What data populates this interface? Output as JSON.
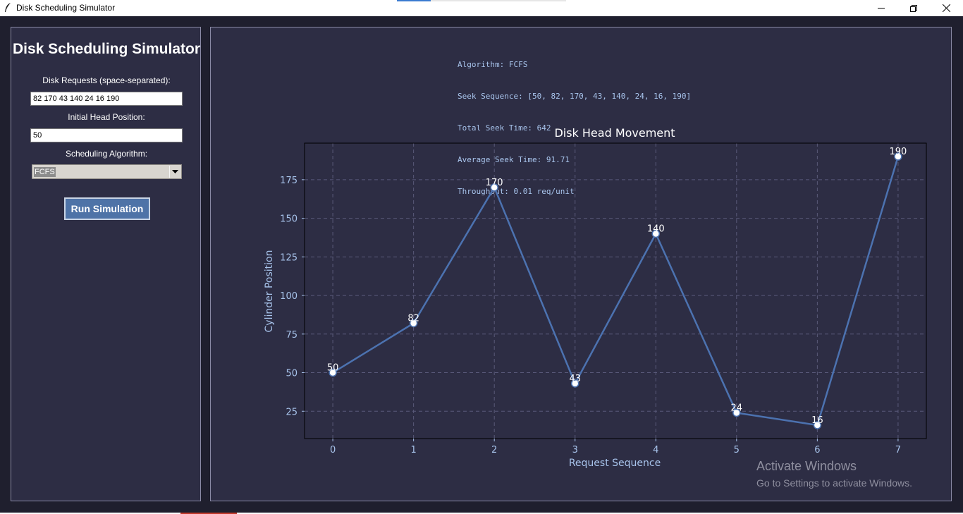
{
  "window": {
    "title": "Disk Scheduling Simulator",
    "icons": [
      "feather-app-icon",
      "minimize-icon",
      "maximize-icon",
      "close-icon"
    ]
  },
  "form": {
    "title": "Disk Scheduling Simulator",
    "requests_label": "Disk Requests (space-separated):",
    "requests_value": "82 170 43 140 24 16 190",
    "head_label": "Initial Head Position:",
    "head_value": "50",
    "algorithm_label": "Scheduling Algorithm:",
    "algorithm_value": "FCFS",
    "run_button": "Run Simulation"
  },
  "results": {
    "algorithm": "Algorithm: FCFS",
    "sequence": "Seek Sequence: [50, 82, 170, 43, 140, 24, 16, 190]",
    "total": "Total Seek Time: 642",
    "average": "Average Seek Time: 91.71",
    "throughput": "Throughput: 0.01 req/unit"
  },
  "chart_data": {
    "type": "line",
    "title": "Disk Head Movement",
    "xlabel": "Request Sequence",
    "ylabel": "Cylinder Position",
    "x": [
      0,
      1,
      2,
      3,
      4,
      5,
      6,
      7
    ],
    "values": [
      50,
      82,
      170,
      43,
      140,
      24,
      16,
      190
    ],
    "point_labels": [
      "50",
      "82",
      "170",
      "43",
      "140",
      "24",
      "16",
      "190"
    ],
    "xticks": [
      "0",
      "1",
      "2",
      "3",
      "4",
      "5",
      "6",
      "7"
    ],
    "yticks": [
      25,
      50,
      75,
      100,
      125,
      150,
      175
    ],
    "xlim": [
      -0.35,
      7.35
    ],
    "ylim": [
      7.3,
      198.7
    ],
    "grid": true,
    "colors": {
      "line": "#4c72b0",
      "marker_fill": "#ffffff",
      "background": "#2d2d44",
      "axis_text": "#a8c4ec",
      "title": "#ffffff",
      "grid": "#5a5a7a"
    }
  },
  "watermark": {
    "line1": "Activate Windows",
    "line2": "Go to Settings to activate Windows."
  }
}
